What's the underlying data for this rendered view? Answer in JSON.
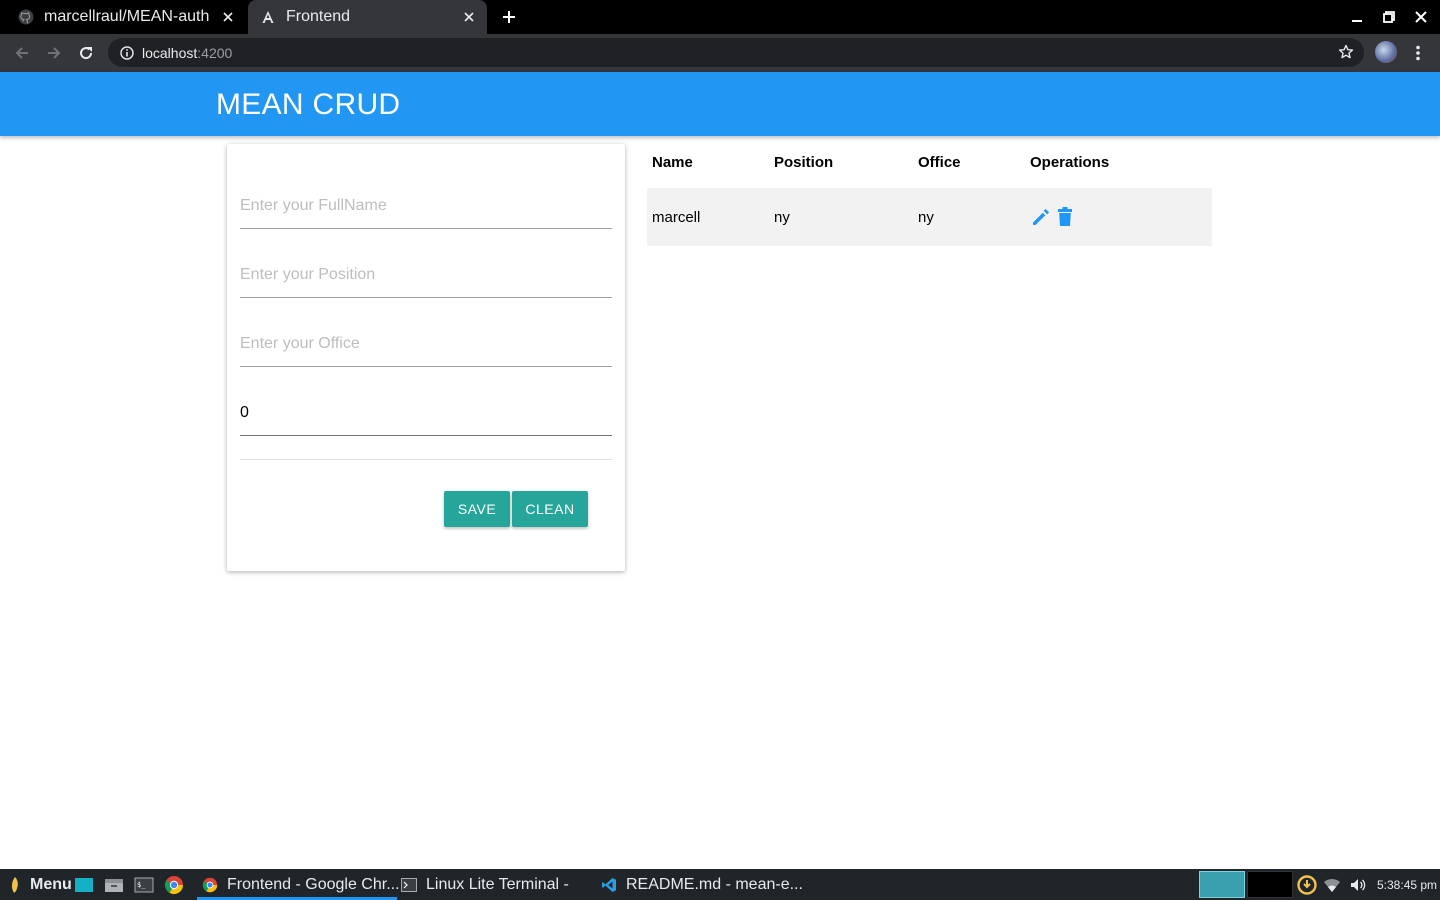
{
  "browser": {
    "tabs": [
      {
        "title": "marcellraul/MEAN-auth",
        "icon": "github-icon",
        "active": false
      },
      {
        "title": "Frontend",
        "icon": "angular-icon",
        "active": true
      }
    ],
    "url_host": "localhost",
    "url_port": ":4200"
  },
  "app": {
    "title": "MEAN CRUD",
    "header_color": "#2196f3",
    "accent_color": "#26a69a"
  },
  "form": {
    "fullname_placeholder": "Enter your FullName",
    "position_placeholder": "Enter your Position",
    "office_placeholder": "Enter your Office",
    "salary_value": "0",
    "save_label": "SAVE",
    "clean_label": "CLEAN"
  },
  "table": {
    "headers": [
      "Name",
      "Position",
      "Office",
      "Operations"
    ],
    "rows": [
      {
        "name": "marcell",
        "position": "ny",
        "office": "ny",
        "operations": [
          "edit-icon",
          "delete-icon"
        ]
      }
    ]
  },
  "taskbar": {
    "menu_label": "Menu",
    "windows": [
      {
        "title": "Frontend - Google Chr...",
        "icon": "chrome-icon",
        "active": true
      },
      {
        "title": "Linux Lite Terminal -",
        "icon": "terminal-icon",
        "active": false
      },
      {
        "title": "README.md - mean-e...",
        "icon": "vscode-icon",
        "active": false
      }
    ],
    "clock": "5:38:45 pm"
  }
}
